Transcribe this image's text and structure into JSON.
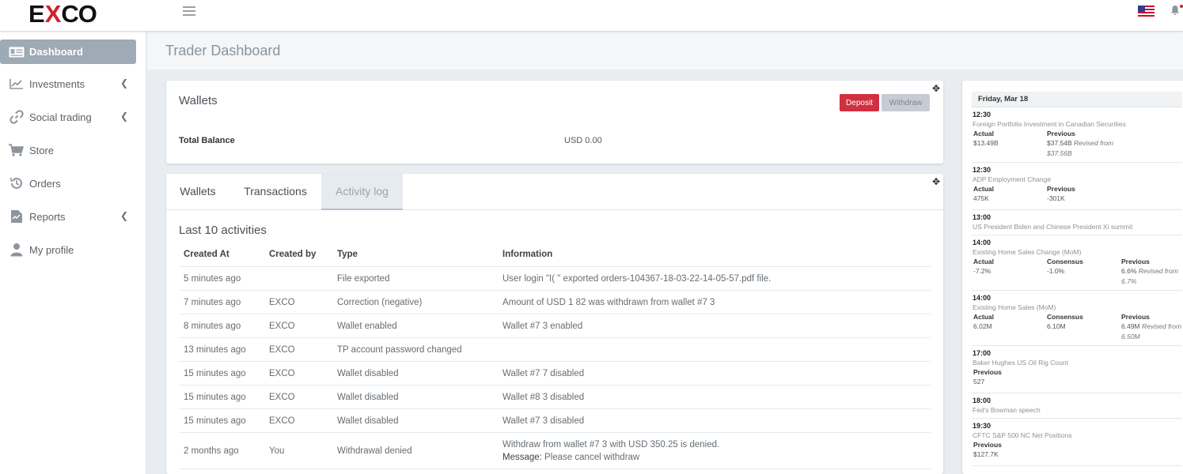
{
  "brand": {
    "logo_left": "E",
    "logo_x": "X",
    "logo_right": "CO"
  },
  "header": {
    "page_title": "Trader Dashboard"
  },
  "sidebar": {
    "items": [
      {
        "label": "Dashboard",
        "icon": "id-card-icon"
      },
      {
        "label": "Investments",
        "icon": "chart-line-icon"
      },
      {
        "label": "Social trading",
        "icon": "link-icon"
      },
      {
        "label": "Store",
        "icon": "cart-icon"
      },
      {
        "label": "Orders",
        "icon": "history-icon"
      },
      {
        "label": "Reports",
        "icon": "report-icon"
      },
      {
        "label": "My profile",
        "icon": "user-icon"
      }
    ]
  },
  "wallets": {
    "title": "Wallets",
    "deposit_label": "Deposit",
    "withdraw_label": "Withdraw",
    "balance_label": "Total Balance",
    "balance_value": "USD 0.00"
  },
  "activity": {
    "tabs": [
      "Wallets",
      "Transactions",
      "Activity log"
    ],
    "section_title": "Last 10 activities",
    "columns": [
      "Created At",
      "Created by",
      "Type",
      "Information"
    ],
    "rows": [
      {
        "created_at": "5 minutes ago",
        "created_by": "",
        "type": "File exported",
        "info": "User login \"I(         \" exported orders-104367-18-03-22-14-05-57.pdf file."
      },
      {
        "created_at": "7 minutes ago",
        "created_by": "EXCO",
        "type": "Correction (negative)",
        "info": "Amount of USD 1        82 was withdrawn from wallet #7         3"
      },
      {
        "created_at": "8 minutes ago",
        "created_by": "EXCO",
        "type": "Wallet enabled",
        "info": "Wallet #7         3 enabled"
      },
      {
        "created_at": "13 minutes ago",
        "created_by": "EXCO",
        "type": "TP account password changed",
        "info": ""
      },
      {
        "created_at": "15 minutes ago",
        "created_by": "EXCO",
        "type": "Wallet disabled",
        "info": "Wallet #7         7 disabled"
      },
      {
        "created_at": "15 minutes ago",
        "created_by": "EXCO",
        "type": "Wallet disabled",
        "info": "Wallet #8         3 disabled"
      },
      {
        "created_at": "15 minutes ago",
        "created_by": "EXCO",
        "type": "Wallet disabled",
        "info": "Wallet #7         3 disabled"
      },
      {
        "created_at": "2 months ago",
        "created_by": "You",
        "type": "Withdrawal denied",
        "info": "Withdraw from wallet #7         3 with USD 350.25 is denied.",
        "message_label": "Message:",
        "message": " Please cancel withdraw"
      }
    ]
  },
  "calendar": {
    "date": "Friday, Mar 18",
    "labels": {
      "actual": "Actual",
      "previous": "Previous",
      "consensus": "Consensus",
      "revised": "Revised from"
    },
    "events": [
      {
        "time": "12:30",
        "name": "Foreign Portfolio Investment in Canadian Securities",
        "actual": "$13.49B",
        "previous": "$37.54B",
        "revised": "$37.56B"
      },
      {
        "time": "12:30",
        "name": "ADP Employment Change",
        "actual": "475K",
        "previous": "-301K"
      },
      {
        "time": "13:00",
        "name": "US President Biden and Chinese President Xi summit"
      },
      {
        "time": "14:00",
        "name": "Existing Home Sales Change (MoM)",
        "actual": "-7.2%",
        "consensus": "-1.0%",
        "previous": "6.6%",
        "revised": "6.7%"
      },
      {
        "time": "14:00",
        "name": "Existing Home Sales (MoM)",
        "actual": "6.02M",
        "consensus": "6.10M",
        "previous": "6.49M",
        "revised": "6.50M"
      },
      {
        "time": "17:00",
        "name": "Baker Hughes US Oil Rig Count",
        "previous": "527"
      },
      {
        "time": "18:00",
        "name": "Fed's Bowman speech"
      },
      {
        "time": "19:30",
        "name": "CFTC S&P 500 NC Net Positions",
        "previous": "$127.7K"
      }
    ]
  }
}
